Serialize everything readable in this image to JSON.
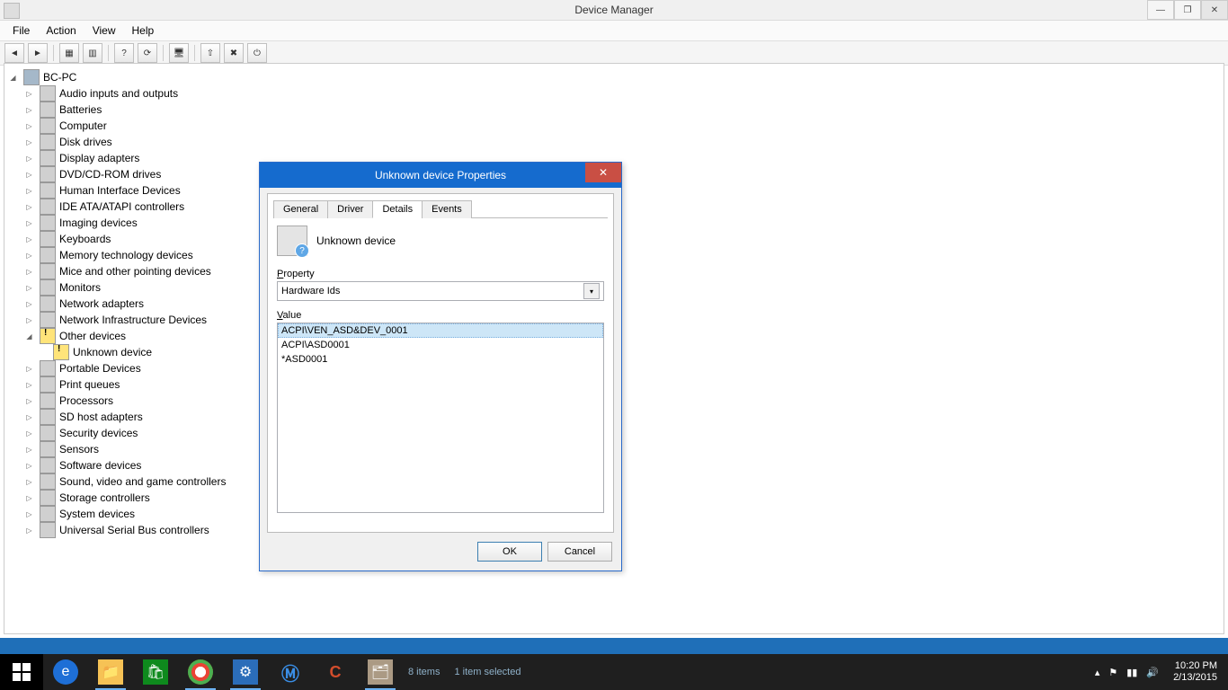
{
  "window": {
    "title": "Device Manager"
  },
  "menu": [
    "File",
    "Action",
    "View",
    "Help"
  ],
  "toolbar_icons": [
    "back",
    "forward",
    "up",
    "properties",
    "help",
    "refresh",
    "scan",
    "uninstall",
    "update",
    "disable",
    "enable"
  ],
  "tree": {
    "root": "BC-PC",
    "nodes": [
      "Audio inputs and outputs",
      "Batteries",
      "Computer",
      "Disk drives",
      "Display adapters",
      "DVD/CD-ROM drives",
      "Human Interface Devices",
      "IDE ATA/ATAPI controllers",
      "Imaging devices",
      "Keyboards",
      "Memory technology devices",
      "Mice and other pointing devices",
      "Monitors",
      "Network adapters",
      "Network Infrastructure Devices"
    ],
    "other_label": "Other devices",
    "unknown_label": "Unknown device",
    "nodes_after": [
      "Portable Devices",
      "Print queues",
      "Processors",
      "SD host adapters",
      "Security devices",
      "Sensors",
      "Software devices",
      "Sound, video and game controllers",
      "Storage controllers",
      "System devices",
      "Universal Serial Bus controllers"
    ]
  },
  "dialog": {
    "title": "Unknown device Properties",
    "tabs": [
      "General",
      "Driver",
      "Details",
      "Events"
    ],
    "active_tab": 2,
    "device_name": "Unknown device",
    "property_label": "Property",
    "property_value": "Hardware Ids",
    "value_label": "Value",
    "values": [
      "ACPI\\VEN_ASD&DEV_0001",
      "ACPI\\ASD0001",
      "*ASD0001"
    ],
    "ok": "OK",
    "cancel": "Cancel"
  },
  "explorer_status": {
    "items": "8 items",
    "selected": "1 item selected"
  },
  "clock": {
    "time": "10:20 PM",
    "date": "2/13/2015"
  }
}
